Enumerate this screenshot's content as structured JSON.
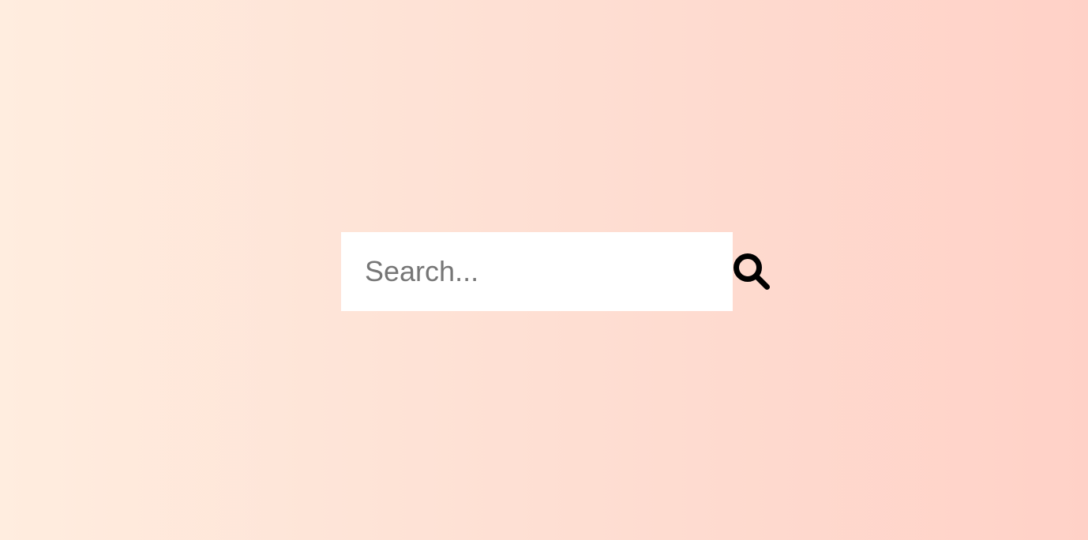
{
  "search": {
    "placeholder": "Search...",
    "value": "",
    "button_icon": "search-icon"
  },
  "colors": {
    "background_start": "#ffeddf",
    "background_end": "#ffd1c7",
    "bar_background": "#ffffff",
    "placeholder": "#767676",
    "icon": "#000000"
  }
}
